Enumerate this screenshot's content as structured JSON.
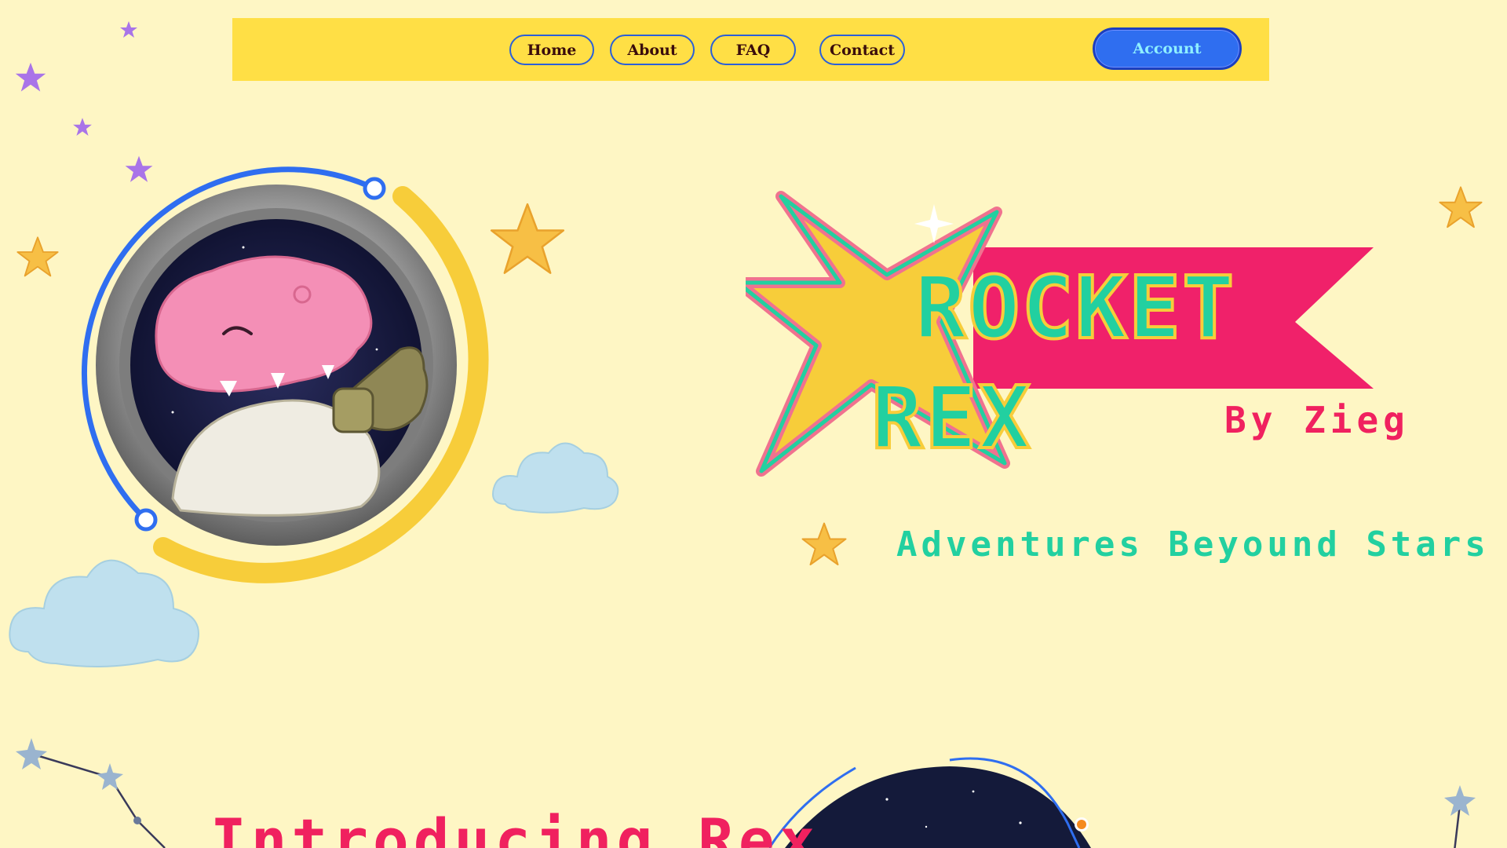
{
  "nav": {
    "items": [
      {
        "label": "Home"
      },
      {
        "label": "About"
      },
      {
        "label": "FAQ"
      },
      {
        "label": "Contact"
      }
    ],
    "account_label": "Account"
  },
  "hero": {
    "logo_word1": "ROCKET",
    "logo_word2": "REX",
    "logo_by": "By Zieg",
    "tagline": "Adventures Beyound Stars",
    "portrait_icon": "dino-astronaut-icon"
  },
  "intro": {
    "title": "Introducing Rex"
  },
  "colors": {
    "background": "#fef6c4",
    "nav_bar": "#ffdf45",
    "nav_border": "#2a5fd9",
    "account_bg": "#2f6ef0",
    "account_text": "#8ff0ff",
    "brand_pink": "#f0215f",
    "brand_teal": "#22d0a0",
    "brand_yellow": "#f7cd3a"
  }
}
